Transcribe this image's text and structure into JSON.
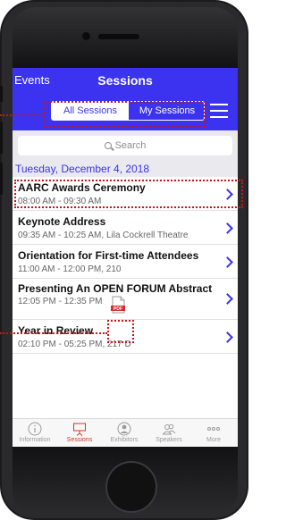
{
  "navbar": {
    "back_label": "Events",
    "title": "Sessions"
  },
  "segments": {
    "all": "All Sessions",
    "mine": "My Sessions"
  },
  "search": {
    "placeholder": "Search"
  },
  "date_header": "Tuesday, December 4, 2018",
  "sessions": [
    {
      "title": "AARC Awards Ceremony",
      "subtitle": "08:00 AM - 09:30 AM"
    },
    {
      "title": "Keynote Address",
      "subtitle": "09:35 AM - 10:25 AM, Lila Cockrell Theatre"
    },
    {
      "title": "Orientation for First-time Attendees",
      "subtitle": "11:00 AM - 12:00 PM, 210"
    },
    {
      "title": "Presenting An OPEN FORUM Abstract",
      "subtitle": "12:05 PM - 12:35 PM",
      "badge": "PDF"
    },
    {
      "title": "Year in Review",
      "subtitle": "02:10 PM - 05:25 PM, 217 D"
    }
  ],
  "tabs": [
    {
      "label": "Information",
      "icon": "info-icon"
    },
    {
      "label": "Sessions",
      "icon": "presentation-icon",
      "active": true
    },
    {
      "label": "Exhibitors",
      "icon": "person-icon"
    },
    {
      "label": "Speakers",
      "icon": "people-icon"
    },
    {
      "label": "More",
      "icon": "more-icon"
    }
  ],
  "colors": {
    "brand": "#3b33f0",
    "active_tab": "#d0362a",
    "callout": "#c6161b"
  }
}
